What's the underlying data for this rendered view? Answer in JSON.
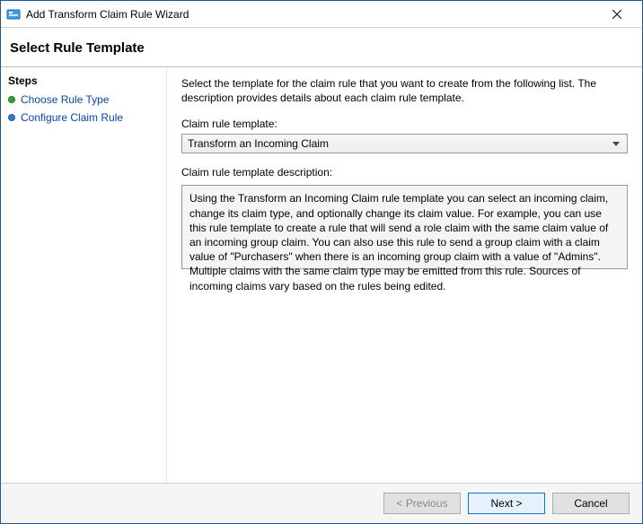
{
  "window": {
    "title": "Add Transform Claim Rule Wizard"
  },
  "header": {
    "page_title": "Select Rule Template"
  },
  "sidebar": {
    "heading": "Steps",
    "items": [
      {
        "label": "Choose Rule Type",
        "state": "done"
      },
      {
        "label": "Configure Claim Rule",
        "state": "current"
      }
    ]
  },
  "main": {
    "instruction": "Select the template for the claim rule that you want to create from the following list. The description provides details about each claim rule template.",
    "template_label": "Claim rule template:",
    "template_selected": "Transform an Incoming Claim",
    "desc_label": "Claim rule template description:",
    "desc_text": "Using the Transform an Incoming Claim rule template you can select an incoming claim, change its claim type, and optionally change its claim value.  For example, you can use this rule template to create a rule that will send a role claim with the same claim value of an incoming group claim.  You can also use this rule to send a group claim with a claim value of \"Purchasers\" when there is an incoming group claim with a value of \"Admins\".  Multiple claims with the same claim type may be emitted from this rule.  Sources of incoming claims vary based on the rules being edited."
  },
  "footer": {
    "previous": "< Previous",
    "next": "Next >",
    "cancel": "Cancel"
  }
}
